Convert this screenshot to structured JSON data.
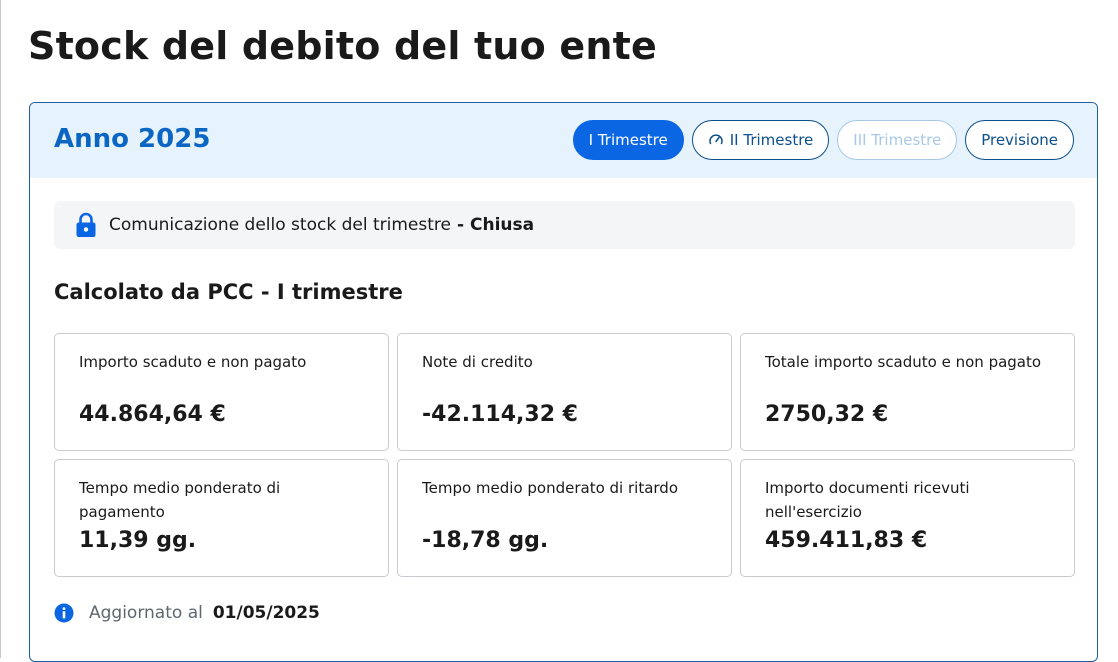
{
  "page": {
    "title": "Stock del debito del tuo ente"
  },
  "card": {
    "year_title": "Anno 2025",
    "tabs": [
      {
        "label": "I Trimestre",
        "state": "active"
      },
      {
        "label": "II Trimestre",
        "state": "in-progress",
        "icon": "gauge-icon"
      },
      {
        "label": "III Trimestre",
        "state": "disabled"
      },
      {
        "label": "Previsione",
        "state": "default"
      }
    ],
    "status": {
      "icon": "lock-icon",
      "text": "Comunicazione dello stock del trimestre",
      "separator": "-",
      "value": "Chiusa"
    },
    "section_title": "Calcolato da PCC - I trimestre",
    "metrics": [
      {
        "label": "Importo scaduto e non pagato",
        "value": "44.864,64 €"
      },
      {
        "label": "Note di credito",
        "value": "-42.114,32 €"
      },
      {
        "label": "Totale importo scaduto e non pagato",
        "value": "2750,32 €"
      },
      {
        "label": "Tempo medio ponderato di pagamento",
        "value": "11,39 gg."
      },
      {
        "label": "Tempo medio ponderato di ritardo",
        "value": "-18,78 gg."
      },
      {
        "label": "Importo documenti ricevuti nell'esercizio",
        "value": "459.411,83 €"
      }
    ],
    "footer": {
      "icon": "info-icon",
      "label": "Aggiornato al",
      "date": "01/05/2025"
    }
  },
  "colors": {
    "primary": "#0b66e4",
    "title_blue": "#0b66c3",
    "header_bg": "#e6f2fc",
    "tab_border": "#0b4f8c",
    "disabled": "#a9c8e6"
  }
}
